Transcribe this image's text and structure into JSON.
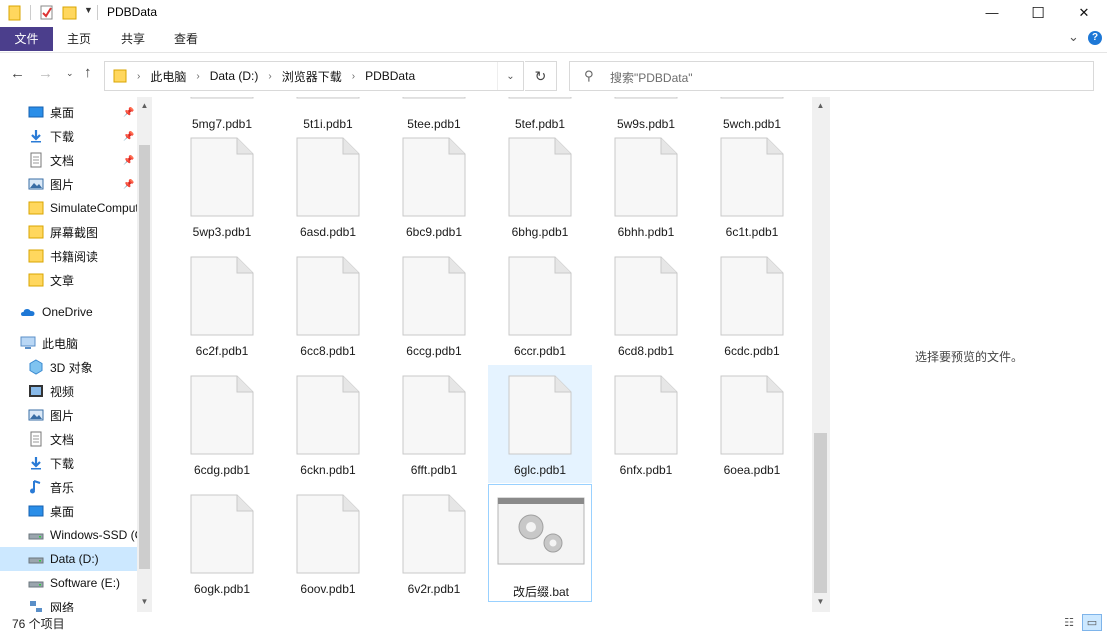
{
  "window": {
    "title": "PDBData",
    "minimize_glyph": "—",
    "maximize_glyph": "☐",
    "close_glyph": "✕"
  },
  "ribbon": {
    "tabs": [
      "文件",
      "主页",
      "共享",
      "查看"
    ],
    "expand_glyph": "⌄",
    "help_glyph": "?"
  },
  "address": {
    "crumbs": [
      "此电脑",
      "Data (D:)",
      "浏览器下载",
      "PDBData"
    ],
    "search_placeholder": "搜索\"PDBData\""
  },
  "nav": {
    "items": [
      {
        "label": "桌面",
        "icon": "desktop-icon",
        "pinned": true
      },
      {
        "label": "下载",
        "icon": "download-icon",
        "pinned": true
      },
      {
        "label": "文档",
        "icon": "document-icon",
        "pinned": true
      },
      {
        "label": "图片",
        "icon": "picture-icon",
        "pinned": true
      },
      {
        "label": "SimulateComputer",
        "icon": "folder-icon",
        "pinned": false
      },
      {
        "label": "屏幕截图",
        "icon": "folder-icon",
        "pinned": false
      },
      {
        "label": "书籍阅读",
        "icon": "folder-icon",
        "pinned": false
      },
      {
        "label": "文章",
        "icon": "folder-icon",
        "pinned": false
      },
      {
        "label": "OneDrive",
        "icon": "onedrive-icon",
        "pinned": false
      },
      {
        "label": "此电脑",
        "icon": "this-pc-icon",
        "pinned": false
      },
      {
        "label": "3D 对象",
        "icon": "3d-objects-icon",
        "pinned": false
      },
      {
        "label": "视频",
        "icon": "video-icon",
        "pinned": false
      },
      {
        "label": "图片",
        "icon": "picture-icon",
        "pinned": false
      },
      {
        "label": "文档",
        "icon": "document-icon",
        "pinned": false
      },
      {
        "label": "下载",
        "icon": "download-icon",
        "pinned": false
      },
      {
        "label": "音乐",
        "icon": "music-icon",
        "pinned": false
      },
      {
        "label": "桌面",
        "icon": "desktop-icon",
        "pinned": false
      },
      {
        "label": "Windows-SSD (C:)",
        "icon": "drive-icon",
        "pinned": false
      },
      {
        "label": "Data (D:)",
        "icon": "drive-icon",
        "pinned": false,
        "selected": true
      },
      {
        "label": "Software (E:)",
        "icon": "drive-icon",
        "pinned": false
      },
      {
        "label": "网络",
        "icon": "network-icon",
        "pinned": false
      }
    ]
  },
  "files": [
    [
      "5mg7.pdb1",
      "5t1i.pdb1",
      "5tee.pdb1",
      "5tef.pdb1",
      "5w9s.pdb1",
      "5wch.pdb1"
    ],
    [
      "5wp3.pdb1",
      "6asd.pdb1",
      "6bc9.pdb1",
      "6bhg.pdb1",
      "6bhh.pdb1",
      "6c1t.pdb1"
    ],
    [
      "6c2f.pdb1",
      "6cc8.pdb1",
      "6ccg.pdb1",
      "6ccr.pdb1",
      "6cd8.pdb1",
      "6cdc.pdb1"
    ],
    [
      "6cdg.pdb1",
      "6ckn.pdb1",
      "6fft.pdb1",
      "6glc.pdb1",
      "6nfx.pdb1",
      "6oea.pdb1"
    ],
    [
      "6ogk.pdb1",
      "6oov.pdb1",
      "6v2r.pdb1",
      "改后缀.bat"
    ]
  ],
  "preview": {
    "message": "选择要预览的文件。"
  },
  "status": {
    "item_count": "76 个项目"
  }
}
